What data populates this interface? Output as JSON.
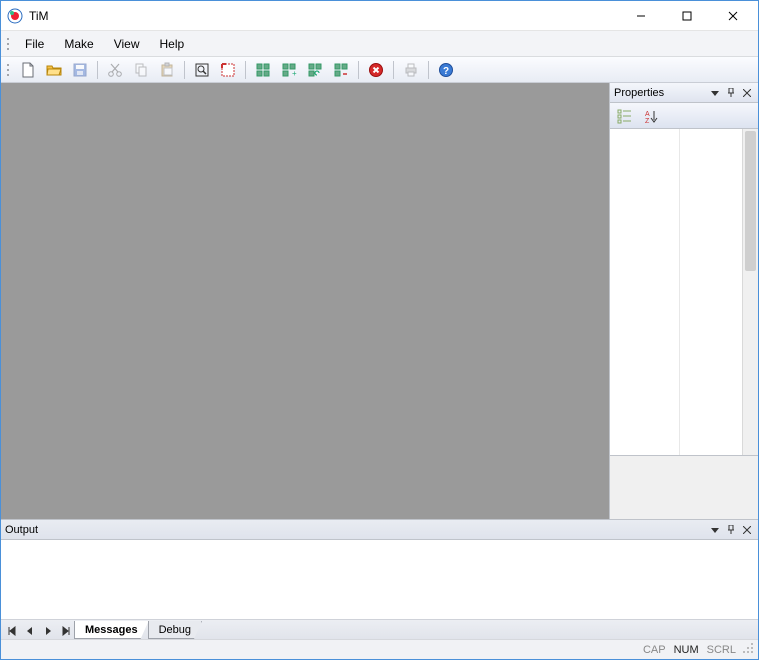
{
  "app": {
    "title": "TiM"
  },
  "menu": {
    "file": "File",
    "make": "Make",
    "view": "View",
    "help": "Help"
  },
  "toolbar_icons": {
    "new": "new-file-icon",
    "open": "open-folder-icon",
    "save": "save-icon",
    "cut": "cut-icon",
    "copy": "copy-icon",
    "paste": "paste-icon",
    "zoom_box": "zoom-box-icon",
    "select_region": "select-region-icon",
    "layout1": "layout-icon",
    "layout2": "layout-plus-icon",
    "layout3": "layout-refresh-icon",
    "layout4": "layout-minus-icon",
    "stop": "stop-icon",
    "print": "print-icon",
    "help": "help-icon"
  },
  "panels": {
    "properties_title": "Properties",
    "output_title": "Output"
  },
  "output_tabs": {
    "messages": "Messages",
    "debug": "Debug"
  },
  "status": {
    "cap": "CAP",
    "num": "NUM",
    "scrl": "SCRL",
    "cap_active": false,
    "num_active": true,
    "scrl_active": false
  }
}
